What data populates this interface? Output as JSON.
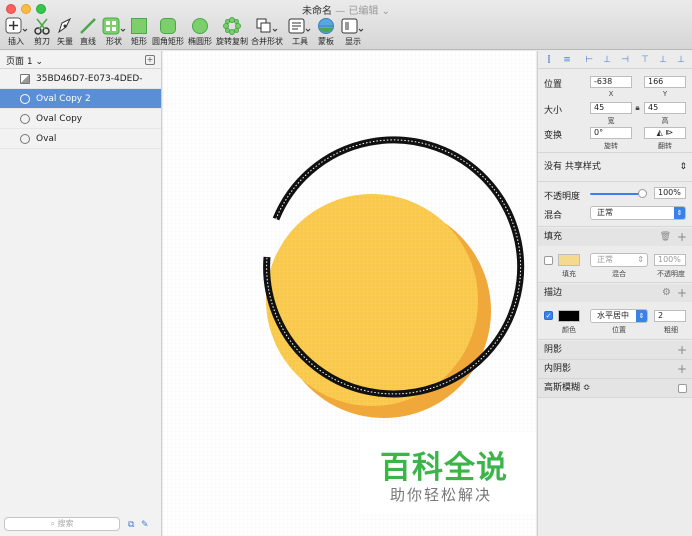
{
  "window": {
    "title": "未命名",
    "edited": "— 已编辑"
  },
  "toolbar": [
    {
      "label": "插入",
      "icon": "plus-icon"
    },
    {
      "label": "剪刀",
      "icon": "scissors-icon"
    },
    {
      "label": "矢量",
      "icon": "pen-icon"
    },
    {
      "label": "直线",
      "icon": "line-icon"
    },
    {
      "label": "形状",
      "icon": "shapes-icon"
    },
    {
      "label": "矩形",
      "icon": "rectangle-icon"
    },
    {
      "label": "圆角矩形",
      "icon": "rounded-rectangle-icon"
    },
    {
      "label": "椭圆形",
      "icon": "oval-icon"
    },
    {
      "label": "旋转复制",
      "icon": "rotate-copy-icon"
    },
    {
      "label": "合并形状",
      "icon": "combine-shapes-icon"
    },
    {
      "label": "工具",
      "icon": "tools-icon"
    },
    {
      "label": "蒙板",
      "icon": "mask-icon"
    },
    {
      "label": "显示",
      "icon": "view-icon"
    }
  ],
  "pages": {
    "current": "页面 1",
    "add_icon": "add-page-icon"
  },
  "layers": [
    {
      "name": "35BD46D7-E073-4DED-892...",
      "type": "image",
      "selected": false
    },
    {
      "name": "Oval Copy 2",
      "type": "oval",
      "selected": true
    },
    {
      "name": "Oval Copy",
      "type": "oval",
      "selected": false
    },
    {
      "name": "Oval",
      "type": "oval",
      "selected": false
    }
  ],
  "search": {
    "placeholder": "搜索"
  },
  "inspector": {
    "position_label": "位置",
    "x": "-638",
    "y": "166",
    "x_label": "X",
    "y_label": "Y",
    "size_label": "大小",
    "width": "45",
    "height": "45",
    "width_label": "宽",
    "height_label": "高",
    "transform_label": "变换",
    "rotation": "0°",
    "rotation_label": "旋转",
    "flip_label": "翻转",
    "shared_style": "没有 共享样式",
    "opacity_label": "不透明度",
    "opacity": "100%",
    "blend_label": "混合",
    "blend": "正常",
    "fill_header": "填充",
    "fill_color": "#f5d98c",
    "fill_blend": "正常",
    "fill_opacity": "100%",
    "fill_sub_color": "填充",
    "fill_sub_blend": "混合",
    "fill_sub_opacity": "不透明度",
    "border_header": "描边",
    "border_color": "#000000",
    "border_position": "水平居中",
    "border_thickness": "2",
    "border_sub_color": "颜色",
    "border_sub_position": "位置",
    "border_sub_thickness": "粗细",
    "shadow_header": "阴影",
    "inner_shadow_header": "内阴影",
    "blur_header": "高斯模糊 ≎"
  },
  "watermark": {
    "title": "百科全说",
    "subtitle": "助你轻松解决"
  },
  "colors": {
    "yellow": "#f7c84b",
    "orange": "#f0a83a",
    "selection": "#5a8fd6",
    "accent": "#3b82e8",
    "watermark_green": "#3bb54a"
  }
}
